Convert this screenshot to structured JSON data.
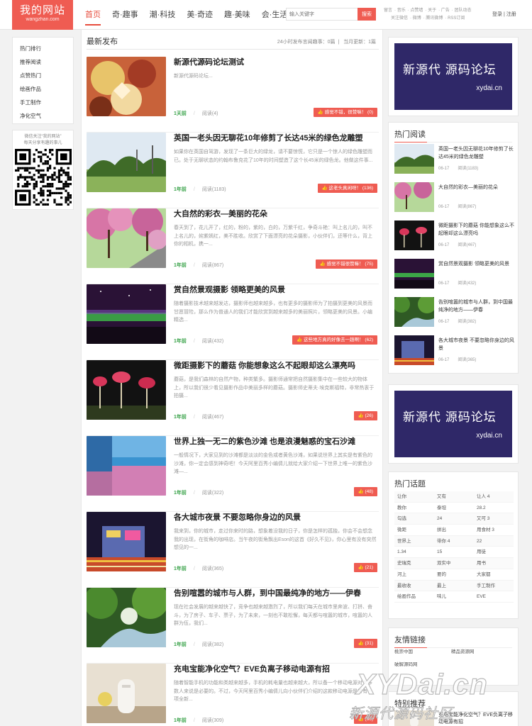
{
  "header": {
    "logo_title": "我的网站",
    "logo_sub": "wangzhan.com",
    "nav": [
      "首页",
      "奇·趣事",
      "潮·科技",
      "美·奇迹",
      "趣·美味",
      "会·生活"
    ],
    "search_placeholder": "输入关键字",
    "search_button": "搜索",
    "top_links_1": [
      "留言",
      "音乐",
      "点赞墙",
      "关于",
      "广告",
      "团队动态"
    ],
    "top_links_2": [
      "关注微信",
      "微博",
      "腾讯微博",
      "RSS订阅"
    ],
    "login": "登录",
    "register": "注册"
  },
  "sidebar": {
    "menu": [
      "热门排行",
      "推荐阅读",
      "点赞热门",
      "绘画作品",
      "手工制作",
      "净化空气"
    ],
    "qr_text_1": "微信关注“我的网站”",
    "qr_text_2": "每天分享有趣的事儿"
  },
  "main": {
    "title": "最新发布",
    "stats_left": "24小时发布言闻趣事：0篇",
    "stats_right": "当月更新：1篇",
    "read_prefix": "阅读",
    "articles": [
      {
        "title": "新源代源码论坛测试",
        "summary": "新源代源码论坛...",
        "time": "1天前",
        "read": "阅读(4)",
        "like": "感觉不错，很赞嘛！ (0)"
      },
      {
        "title": "英国一老头因无聊花10年修剪了长达45米的绿色龙雕塑",
        "summary": "如果你在英国自驾游，发现了一条巨大的绿龙，请不要惊慌，它只是一个惊人的绿色雕塑而已。处于无聊状态的约翰布鲁克花了10年的时间塑造了这个长45米的绿色龙。他做这件事...",
        "time": "1年前",
        "read": "阅读(1183)",
        "like": "这老头真闲呀！ (136)"
      },
      {
        "title": "大自然的彩衣—美丽的花朵",
        "summary": "春天到了，花儿开了，红的，粉的，紫的，白的，万紫千红，争奇斗艳：叫上名儿的，叫不上名儿的，姹紫嫣红，美不胜收。欣赏了下面漂亮的花朵摄影，小伙伴们，还等什么，背上你的相机，携一...",
        "time": "1年前",
        "read": "阅读(867)",
        "like": "感觉不错很赞嘛！ (75)"
      },
      {
        "title": "赏自然景观摄影 领略更美的风景",
        "summary": "随着摄影技术越来越发达，摄影师也越来越多，也有更多的摄影师为了拍摄到更美的风景而甘愿冒险，那么作为普通人的我们才能欣赏到越来越多的美丽照片，领略更美的风景。小编精选...",
        "time": "1年前",
        "read": "阅读(432)",
        "like": "这些地方真的好像去一趟啊！ (62)"
      },
      {
        "title": "微距摄影下的蘑菇 你能想象这么不起眼却这么漂亮吗",
        "summary": "蘑菇，是我们森林的自然产物，种类繁多。摄影师通常把自然摄影集中在一些较大的物体上，所以我们很少看见摄影作品中美丽多样的蘑菇。摄影师史蒂夫·埃克斯福特，非常热衷于拍摄...",
        "time": "1年前",
        "read": "阅读(467)",
        "like": "(26)"
      },
      {
        "title": "世界上独一无二的紫色沙滩 也是浪漫魅惑的宝石沙滩",
        "summary": "一般情况下，大家见到的沙滩都是淡淡的金色或者黄色沙滩，如果说世界上其实是有紫色的沙滩，你一定会感到神奇吧！今天阿里百秀小编倩儿就给大家介绍一下世界上唯一的紫色沙滩—...",
        "time": "1年前",
        "read": "阅读(322)",
        "like": "(48)"
      },
      {
        "title": "各大城市夜景 不要忽略你身边的风景",
        "summary": "我来到，你的城市，走过你来时的路，想象着没我的日子，你是怎样的孤独，你会不会想念我的出现，在街角的咖啡店。当午夜的街角飘出Eson的这首《好久不见》，你心里有没有突然想见的一...",
        "time": "1年前",
        "read": "阅读(365)",
        "like": "(21)"
      },
      {
        "title": "告别喧嚣的城市与人群，到中国最纯净的地方——伊春",
        "summary": "现在社会发展的越来越快了，竞争也越来越激烈了，所以我们每天在城市里奔波、打拼、奋斗，为了房子、车子、票子，为了未来，一刻也不敢松懈，每天都与喧嚣的城市，喧嚣的人群为伍，我们...",
        "time": "1年前",
        "read": "阅读(382)",
        "like": "(31)"
      },
      {
        "title": "充电宝能净化空气？EVE负离子移动电源有招",
        "summary": "随着智能手机的功能和类越来越多，手机的耗电量也越来越大，所以备一个移动电源对大多数人来说是必要的。不过，今天阿里百秀小编倩儿向小伙伴们介绍的这款移动电源是带有一项全新...",
        "time": "1年前",
        "read": "阅读(309)",
        "like": "(66)"
      }
    ]
  },
  "right": {
    "ad_main": "新源代 源码论坛",
    "ad_sub": "xydai.cn",
    "hot_title": "热门阅读",
    "hot": [
      {
        "title": "英国一老头因无聊花10年修剪了长达45米的绿色龙雕塑",
        "date": "06-17",
        "read": "阅读(1183)"
      },
      {
        "title": "大自然的彩衣—美丽的花朵",
        "date": "06-17",
        "read": "阅读(867)"
      },
      {
        "title": "微距摄影下的蘑菇 你能想象这么不起眼却这么漂亮吗",
        "date": "06-17",
        "read": "阅读(467)"
      },
      {
        "title": "赏自然景观摄影 领略更美的风景",
        "date": "06-17",
        "read": "阅读(432)"
      },
      {
        "title": "告别喧嚣的城市与人群，到中国最纯净的地方——伊春",
        "date": "06-17",
        "read": "阅读(382)"
      },
      {
        "title": "各大城市夜景 不要忽略你身边的风景",
        "date": "06-17",
        "read": "阅读(365)"
      }
    ],
    "topics_title": "热门话题",
    "topics": [
      [
        "让你",
        "又有",
        "让人 4"
      ],
      [
        "教你",
        "泰坦",
        "28.2"
      ],
      [
        "勾选",
        "24",
        "又可 3"
      ],
      [
        "微距",
        "拼出",
        "用食材 3"
      ],
      [
        "世界上",
        "带你 4",
        "22"
      ],
      [
        "1.34",
        "15",
        "用徒"
      ],
      [
        "史瑞克",
        "双实中",
        "用书"
      ],
      [
        "河上",
        "要的",
        "大家都"
      ],
      [
        "最收收",
        "最上",
        "手工制作"
      ],
      [
        "绘画作品",
        "味儿",
        "EVE"
      ]
    ],
    "links_title": "友情链接",
    "links": [
      "桃崇中国",
      "精品资源网",
      "破解源码网"
    ],
    "rec_title": "特别推荐",
    "rec_item": "充电宝能净化空气？EVE负离子移动电源有招"
  },
  "watermark": {
    "big": "XYDai.cn",
    "small": "新源代源码社区"
  }
}
